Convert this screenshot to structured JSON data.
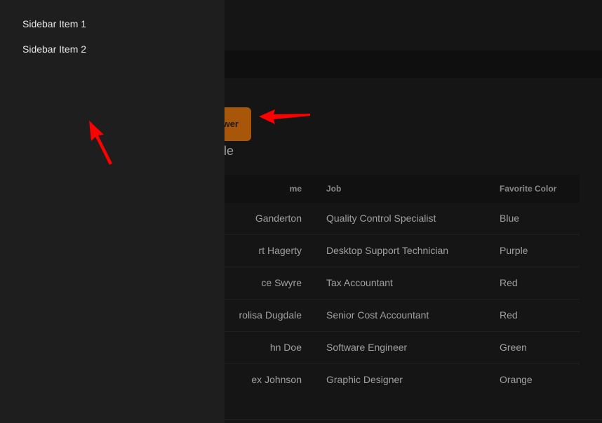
{
  "sidebar": {
    "items": [
      {
        "label": "Sidebar Item 1"
      },
      {
        "label": "Sidebar Item 2"
      }
    ]
  },
  "main": {
    "drawer_button_label": "Open Drawer",
    "drawer_button_visible": "wer",
    "table_title_visible": "le",
    "table": {
      "columns": [
        "me",
        "Job",
        "Favorite Color"
      ],
      "rows": [
        {
          "name": "Ganderton",
          "job": "Quality Control Specialist",
          "color": "Blue"
        },
        {
          "name": "rt Hagerty",
          "job": "Desktop Support Technician",
          "color": "Purple"
        },
        {
          "name": "ce Swyre",
          "job": "Tax Accountant",
          "color": "Red"
        },
        {
          "name": "rolisa Dugdale",
          "job": "Senior Cost Accountant",
          "color": "Red"
        },
        {
          "name": "hn Doe",
          "job": "Software Engineer",
          "color": "Green"
        },
        {
          "name": "ex Johnson",
          "job": "Graphic Designer",
          "color": "Orange"
        }
      ]
    }
  },
  "colors": {
    "accent": "#a8560a",
    "annotation_arrow": "#ff0000",
    "sidebar_bg": "#1e1e1e",
    "page_bg": "#151515"
  }
}
